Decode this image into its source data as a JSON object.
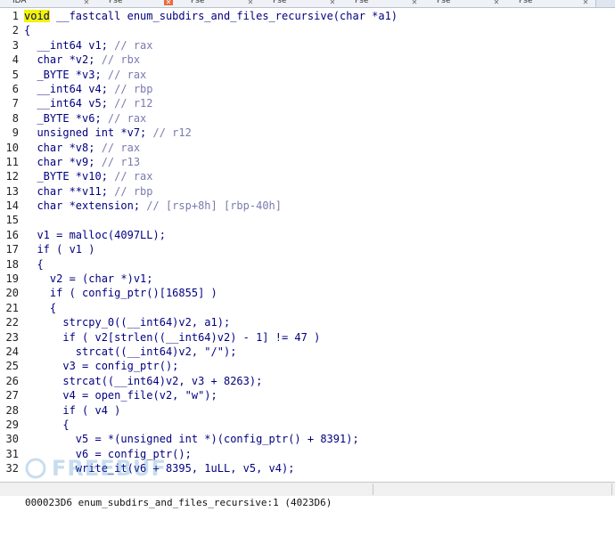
{
  "tabs": [
    {
      "label": "IDA",
      "close": "✕",
      "active": false
    },
    {
      "label": "Pse",
      "close": "✕",
      "active": true
    },
    {
      "label": "Pse",
      "close": "✕",
      "active": false
    },
    {
      "label": "Pse",
      "close": "✕",
      "active": false
    },
    {
      "label": "Pse",
      "close": "✕",
      "active": false
    },
    {
      "label": "Pse",
      "close": "✕",
      "active": false
    },
    {
      "label": "Pse",
      "close": "✕",
      "active": false
    }
  ],
  "code_lines": [
    {
      "num": "1",
      "text": "void __fastcall enum_subdirs_and_files_recursive(char *a1)"
    },
    {
      "num": "2",
      "text": "{"
    },
    {
      "num": "3",
      "text": "  __int64 v1; // rax"
    },
    {
      "num": "4",
      "text": "  char *v2; // rbx"
    },
    {
      "num": "5",
      "text": "  _BYTE *v3; // rax"
    },
    {
      "num": "6",
      "text": "  __int64 v4; // rbp"
    },
    {
      "num": "7",
      "text": "  __int64 v5; // r12"
    },
    {
      "num": "8",
      "text": "  _BYTE *v6; // rax"
    },
    {
      "num": "9",
      "text": "  unsigned int *v7; // r12"
    },
    {
      "num": "10",
      "text": "  char *v8; // rax"
    },
    {
      "num": "11",
      "text": "  char *v9; // r13"
    },
    {
      "num": "12",
      "text": "  _BYTE *v10; // rax"
    },
    {
      "num": "13",
      "text": "  char **v11; // rbp"
    },
    {
      "num": "14",
      "text": "  char *extension; // [rsp+8h] [rbp-40h]"
    },
    {
      "num": "15",
      "text": ""
    },
    {
      "num": "16",
      "text": "  v1 = malloc(4097LL);"
    },
    {
      "num": "17",
      "text": "  if ( v1 )"
    },
    {
      "num": "18",
      "text": "  {"
    },
    {
      "num": "19",
      "text": "    v2 = (char *)v1;"
    },
    {
      "num": "20",
      "text": "    if ( config_ptr()[16855] )"
    },
    {
      "num": "21",
      "text": "    {"
    },
    {
      "num": "22",
      "text": "      strcpy_0((__int64)v2, a1);"
    },
    {
      "num": "23",
      "text": "      if ( v2[strlen((__int64)v2) - 1] != 47 )"
    },
    {
      "num": "24",
      "text": "        strcat((__int64)v2, \"/\");"
    },
    {
      "num": "25",
      "text": "      v3 = config_ptr();"
    },
    {
      "num": "26",
      "text": "      strcat((__int64)v2, v3 + 8263);"
    },
    {
      "num": "27",
      "text": "      v4 = open_file(v2, \"w\");"
    },
    {
      "num": "28",
      "text": "      if ( v4 )"
    },
    {
      "num": "29",
      "text": "      {"
    },
    {
      "num": "30",
      "text": "        v5 = *(unsigned int *)(config_ptr() + 8391);"
    },
    {
      "num": "31",
      "text": "        v6 = config_ptr();"
    },
    {
      "num": "32",
      "text": "        write_it(v6 + 8395, 1uLL, v5, v4);"
    }
  ],
  "status": {
    "text": "000023D6 enum_subdirs_and_files_recursive:1 (4023D6)"
  },
  "watermark": {
    "text": "FREEBUF"
  }
}
